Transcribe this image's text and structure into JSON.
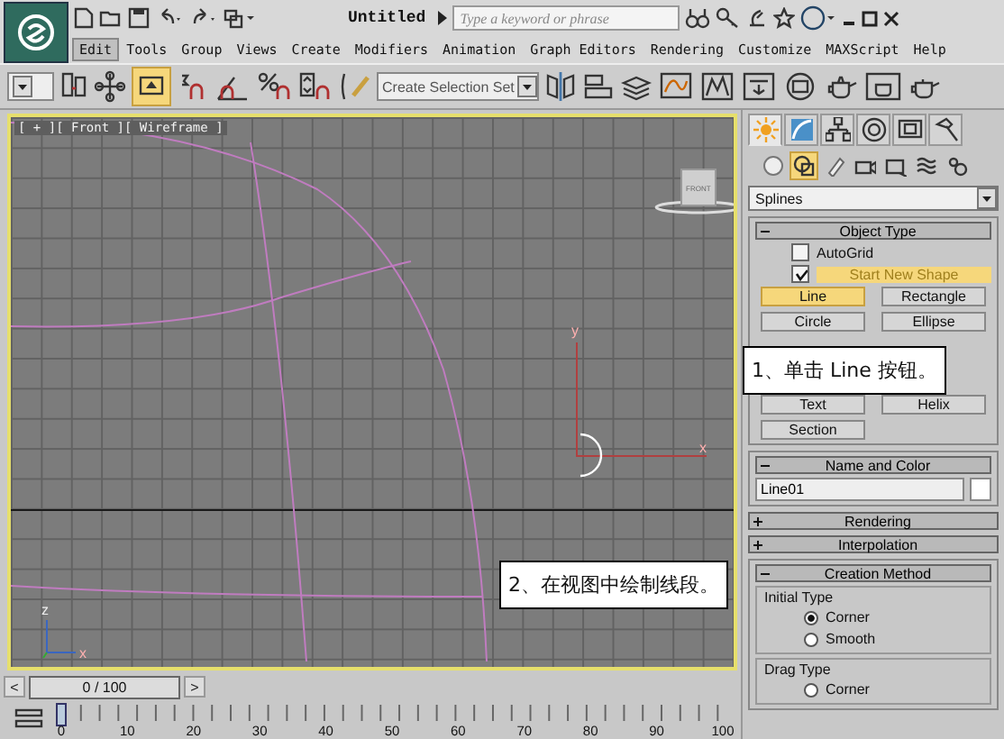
{
  "window": {
    "title": "Untitled",
    "search": {
      "placeholder": "Type a keyword or phrase"
    }
  },
  "menu": [
    {
      "label": "Edit",
      "selected": true
    },
    {
      "label": "Tools",
      "selected": false
    },
    {
      "label": "Group",
      "selected": false
    },
    {
      "label": "Views",
      "selected": false
    },
    {
      "label": "Create",
      "selected": false
    },
    {
      "label": "Modifiers",
      "selected": false
    },
    {
      "label": "Animation",
      "selected": false
    },
    {
      "label": "Graph Editors",
      "selected": false
    },
    {
      "label": "Rendering",
      "selected": false
    },
    {
      "label": "Customize",
      "selected": false
    },
    {
      "label": "MAXScript",
      "selected": false
    },
    {
      "label": "Help",
      "selected": false
    }
  ],
  "toolbar": {
    "selection_set": "Create Selection Set"
  },
  "viewport": {
    "label": "[ + ][ Front ][ Wireframe ]",
    "active": true,
    "viewcube": "FRONT",
    "gizmo": {
      "y": "y",
      "x": "x"
    },
    "tripod": {
      "z": "z",
      "x": "x"
    }
  },
  "callouts": [
    {
      "text": "1、单击 Line 按钮。",
      "kind": "panel"
    },
    {
      "text": "2、在视图中绘制线段。",
      "kind": "viewport"
    }
  ],
  "command_panel": {
    "tabs": [
      {
        "selected": true
      },
      {
        "selected": false
      },
      {
        "selected": false
      },
      {
        "selected": false
      },
      {
        "selected": false
      },
      {
        "selected": false
      }
    ],
    "categories": [
      {
        "selected": false
      },
      {
        "selected": true
      },
      {
        "selected": false
      },
      {
        "selected": false
      },
      {
        "selected": false
      },
      {
        "selected": false
      },
      {
        "selected": false
      }
    ],
    "dropdown": "Splines",
    "rollouts": [
      {
        "kind": "object_type",
        "title": "Object Type",
        "expanded": true,
        "autogrid": {
          "label": "AutoGrid",
          "checked": false
        },
        "start_new_shape": {
          "label": "Start New Shape",
          "checked": true
        },
        "buttons": [
          {
            "label": "Line",
            "selected": true
          },
          {
            "label": "Rectangle",
            "selected": false
          },
          {
            "label": "Circle",
            "selected": false
          },
          {
            "label": "Ellipse",
            "selected": false
          },
          {
            "label": "Text",
            "selected": false
          },
          {
            "label": "Helix",
            "selected": false
          },
          {
            "label": "Section",
            "selected": false
          }
        ]
      },
      {
        "kind": "name_color",
        "title": "Name and Color",
        "expanded": true,
        "name": "Line01"
      },
      {
        "kind": "plain",
        "title": "Rendering",
        "expanded": false
      },
      {
        "kind": "plain",
        "title": "Interpolation",
        "expanded": false
      },
      {
        "kind": "creation_method",
        "title": "Creation Method",
        "expanded": true,
        "groups": [
          {
            "title": "Initial Type",
            "options": [
              {
                "label": "Corner",
                "selected": true
              },
              {
                "label": "Smooth",
                "selected": false
              }
            ]
          },
          {
            "title": "Drag Type",
            "options": [
              {
                "label": "Corner",
                "selected": false
              }
            ]
          }
        ]
      }
    ]
  },
  "time_slider": {
    "label": "0 / 100",
    "prev": "<",
    "next": ">"
  },
  "ruler": {
    "labels": [
      "0",
      "10",
      "20",
      "30",
      "40",
      "50",
      "60",
      "70",
      "80",
      "90",
      "100"
    ]
  }
}
